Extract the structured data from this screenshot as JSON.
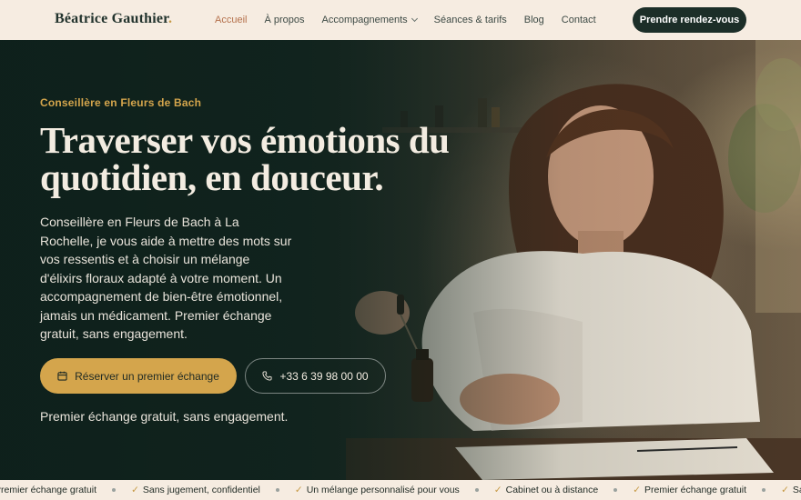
{
  "header": {
    "logo": "Béatrice Gauthier",
    "logo_dot": ".",
    "nav": [
      {
        "label": "Accueil",
        "active": true
      },
      {
        "label": "À propos"
      },
      {
        "label": "Accompagnements",
        "dropdown": true
      },
      {
        "label": "Séances & tarifs"
      },
      {
        "label": "Blog"
      },
      {
        "label": "Contact"
      }
    ],
    "cta": "Prendre rendez-vous"
  },
  "hero": {
    "eyebrow": "Conseillère en Fleurs de Bach",
    "headline_line1": "Traverser vos émotions du",
    "headline_line2": "quotidien, en douceur.",
    "lead": "Conseillère en Fleurs de Bach à La Rochelle, je vous aide à mettre des mots sur vos ressentis et à choisir un mélange d'élixirs floraux adapté à votre moment. Un accompagnement de bien-être émotionnel, jamais un médicament. Premier échange gratuit, sans engagement.",
    "primary_button": "Réserver un premier échange",
    "phone_button": "+33 6 39 98 00 00",
    "note": "Premier échange gratuit, sans engagement."
  },
  "ticker": [
    {
      "label": "Premier échange gratuit",
      "check": false
    },
    {
      "label": "Sans jugement, confidentiel",
      "check": true
    },
    {
      "label": "Un mélange personnalisé pour vous",
      "check": true
    },
    {
      "label": "Cabinet ou à distance",
      "check": true
    },
    {
      "label": "Premier échange gratuit",
      "check": true
    },
    {
      "label": "Sans",
      "check": true
    }
  ],
  "colors": {
    "accent": "#d4a54c",
    "header_bg": "#f6ece1",
    "hero_dark": "#132720",
    "nav_active": "#b5714c"
  }
}
